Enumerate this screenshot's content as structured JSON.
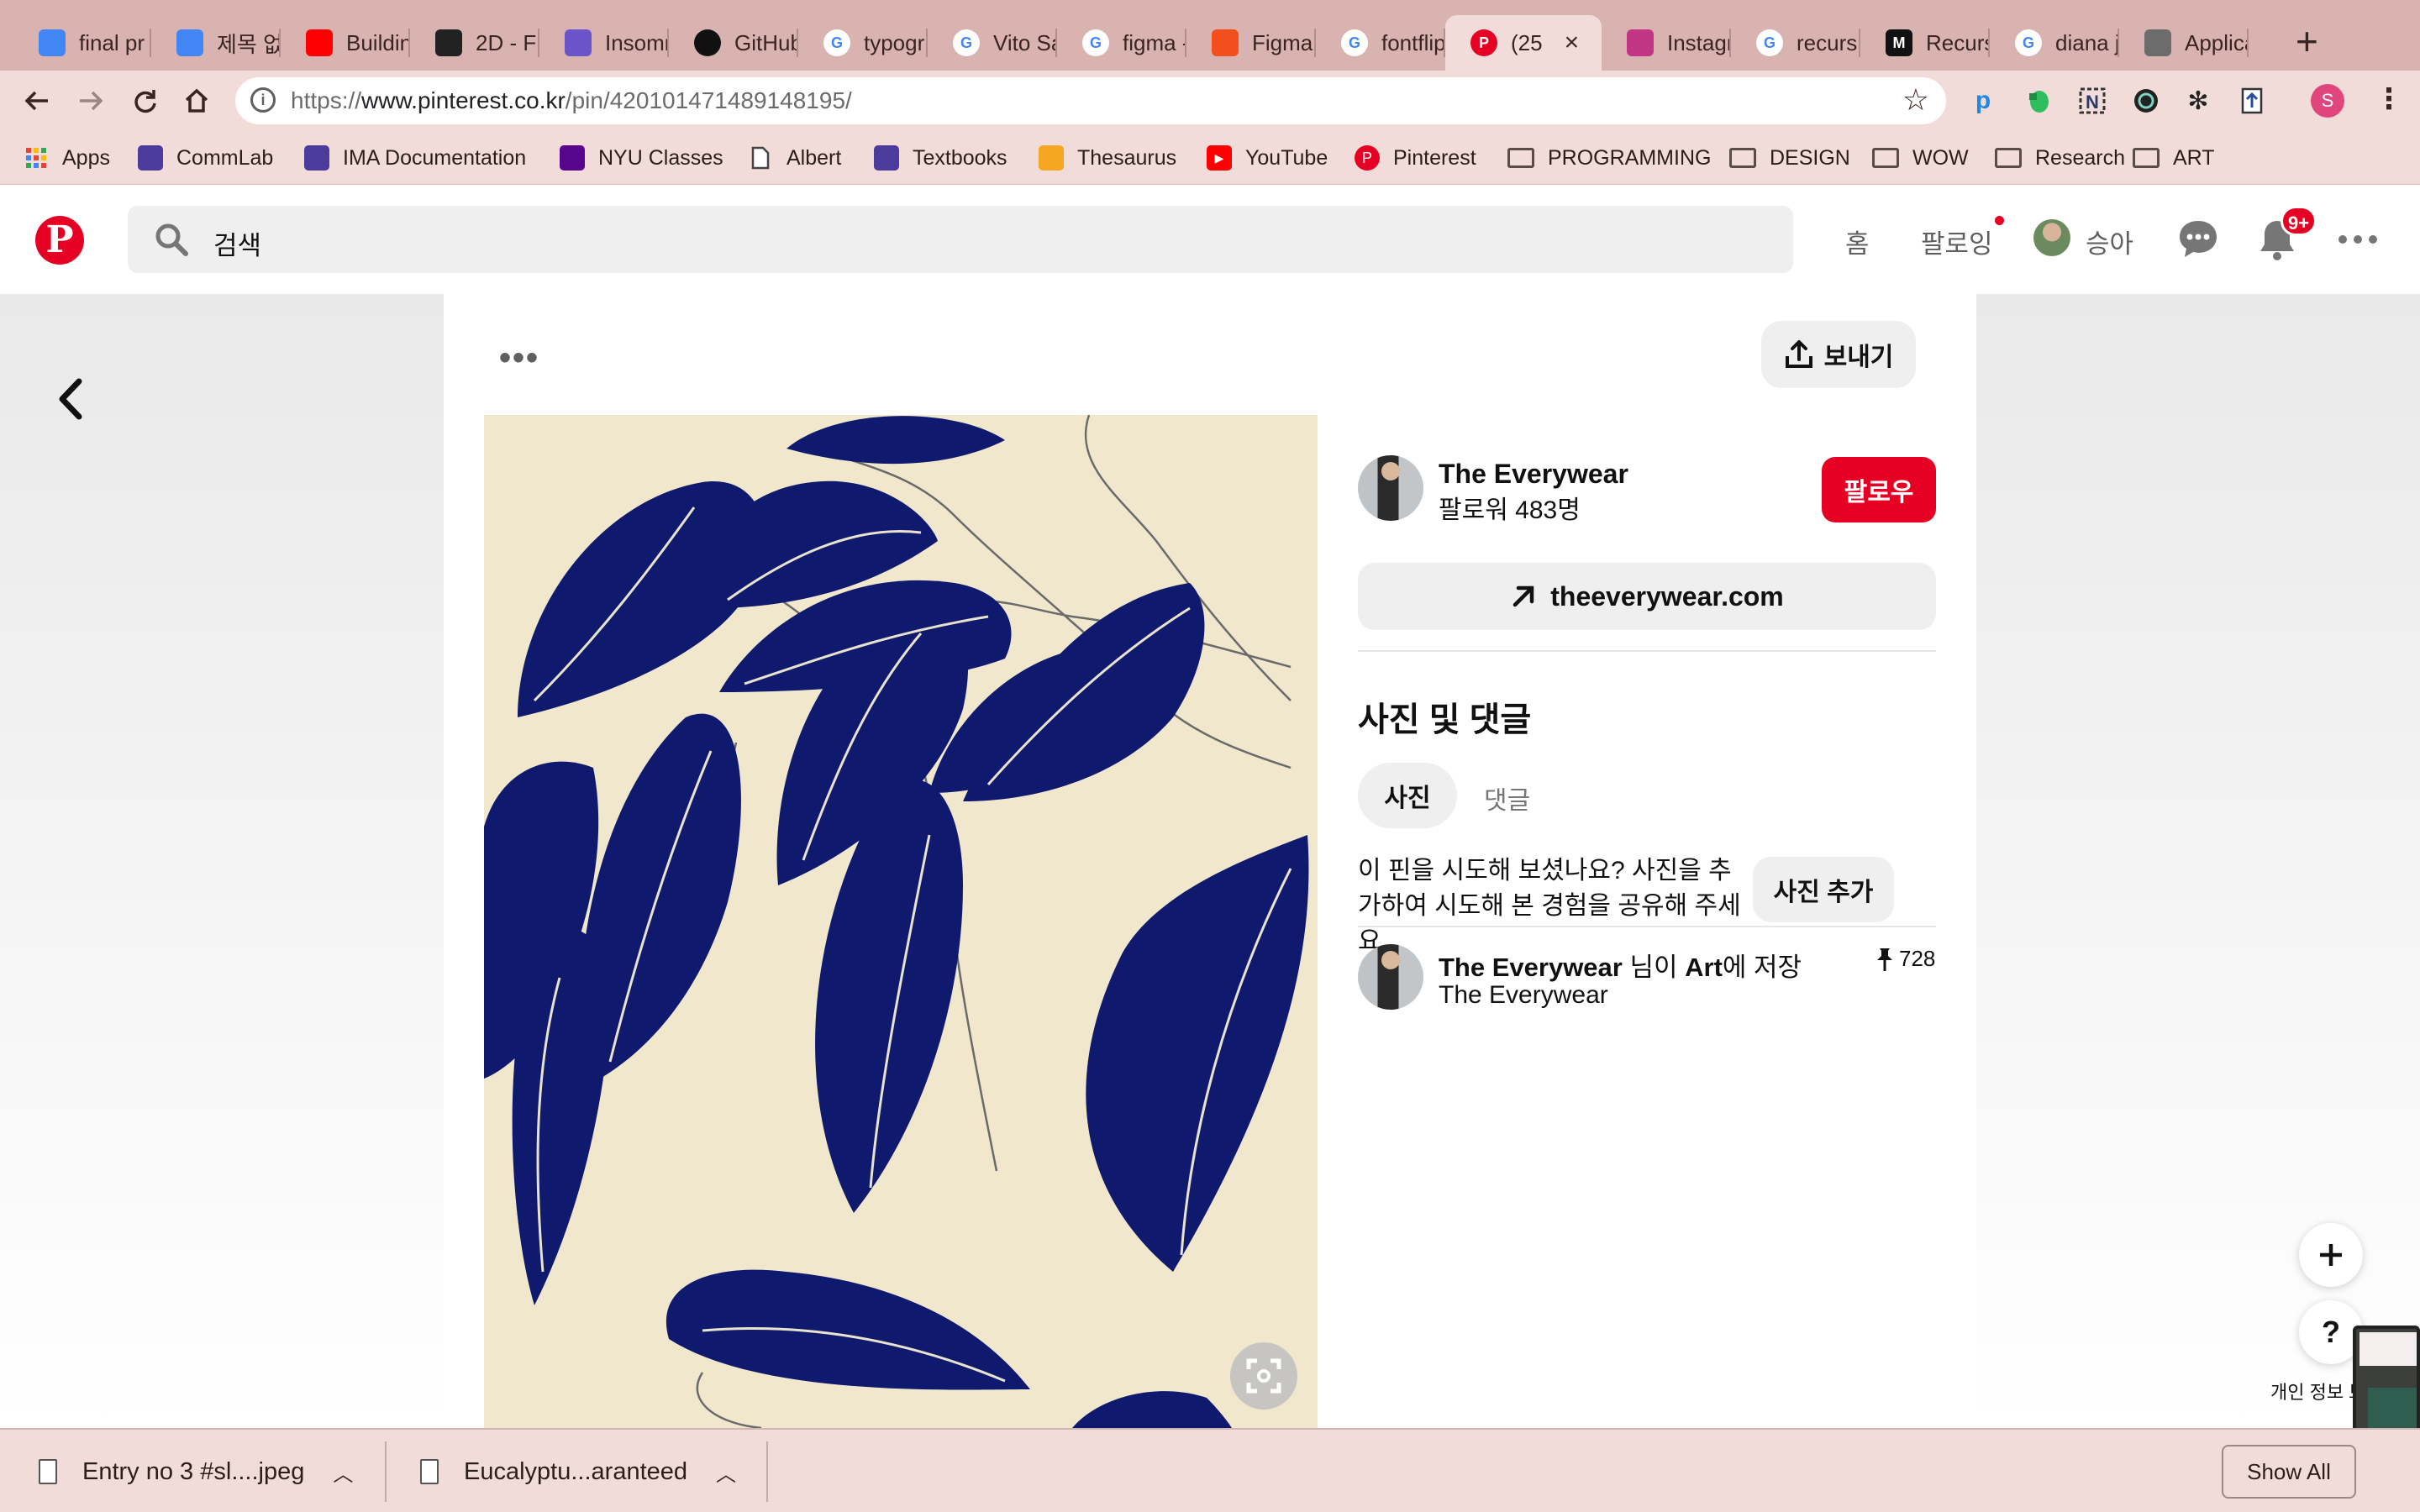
{
  "browser": {
    "tabs": [
      {
        "title": "final pr",
        "icon": "google-docs-icon",
        "color": "#4285f4"
      },
      {
        "title": "제목 없는",
        "icon": "google-docs-icon",
        "color": "#4285f4"
      },
      {
        "title": "Buildin",
        "icon": "youtube-icon",
        "color": "#ff0000"
      },
      {
        "title": "2D - Fl",
        "icon": "2d-logo-icon",
        "color": "#222222"
      },
      {
        "title": "Insomn",
        "icon": "insomnia-icon",
        "color": "#6b54c9"
      },
      {
        "title": "GitHub",
        "icon": "github-icon",
        "color": "#111111"
      },
      {
        "title": "typogr",
        "icon": "google-icon",
        "color": "#ffffff"
      },
      {
        "title": "Vito Sa",
        "icon": "google-icon",
        "color": "#ffffff"
      },
      {
        "title": "figma -",
        "icon": "google-icon",
        "color": "#ffffff"
      },
      {
        "title": "Figma:",
        "icon": "figma-icon",
        "color": "#f24e1e"
      },
      {
        "title": "fontflip",
        "icon": "google-icon",
        "color": "#ffffff"
      },
      {
        "title": "(25",
        "icon": "pinterest-icon",
        "color": "#e60023",
        "active": true
      },
      {
        "title": "Instagr",
        "icon": "instagram-icon",
        "color": "#c13584"
      },
      {
        "title": "recursi",
        "icon": "google-icon",
        "color": "#ffffff"
      },
      {
        "title": "Recurs",
        "icon": "medium-icon",
        "color": "#111111"
      },
      {
        "title": "diana j",
        "icon": "google-icon",
        "color": "#ffffff"
      },
      {
        "title": "Applica",
        "icon": "app-thumbnail-icon",
        "color": "#6c6c6c"
      }
    ],
    "url_prefix": "https://",
    "url_host": "www.pinterest.co.kr",
    "url_path": "/pin/420101471489148195/",
    "bookmarks": [
      {
        "label": "Apps",
        "icon": "apps-grid-icon"
      },
      {
        "label": "CommLab",
        "icon": "bookmark-site-icon"
      },
      {
        "label": "IMA Documentation",
        "icon": "bookmark-site-icon"
      },
      {
        "label": "NYU Classes",
        "icon": "nyu-torch-icon"
      },
      {
        "label": "Albert",
        "icon": "document-icon"
      },
      {
        "label": "Textbooks",
        "icon": "bookmark-site-icon"
      },
      {
        "label": "Thesaurus",
        "icon": "thesaurus-icon"
      },
      {
        "label": "YouTube",
        "icon": "youtube-icon"
      },
      {
        "label": "Pinterest",
        "icon": "pinterest-icon"
      },
      {
        "label": "PROGRAMMING",
        "icon": "folder-icon"
      },
      {
        "label": "DESIGN",
        "icon": "folder-icon"
      },
      {
        "label": "WOW",
        "icon": "folder-icon"
      },
      {
        "label": "Research",
        "icon": "folder-icon"
      },
      {
        "label": "ART",
        "icon": "folder-icon"
      }
    ],
    "profile_initial": "S"
  },
  "pinterest": {
    "search_placeholder": "검색",
    "nav_home": "홈",
    "nav_following": "팔로잉",
    "nav_profile": "승아",
    "notification_badge": "9+",
    "brand_color": "#e60023"
  },
  "pin": {
    "send_label": "보내기",
    "creator_name": "The Everywear",
    "creator_followers": "팔로워 483명",
    "follow_label": "팔로우",
    "link_label": "theeverywear.com",
    "section_title": "사진 및 댓글",
    "tab_photos": "사진",
    "tab_comments": "댓글",
    "prompt_text": "이 핀을 시도해 보셨나요? 사진을 추가하여 시도해 본 경험을 공유해 주세요",
    "add_photo_label": "사진 추가",
    "saved_by": "The Everywear",
    "saved_mid": " 님이 ",
    "saved_board": "Art",
    "saved_suffix": "에 저장",
    "saved_board_owner": "The Everywear",
    "pin_count": "728",
    "privacy_label": "개인 정보 보호"
  },
  "downloads": {
    "items": [
      "Entry no 3 #sl....jpeg",
      "Eucalyptu...aranteed"
    ],
    "show_all": "Show All"
  }
}
